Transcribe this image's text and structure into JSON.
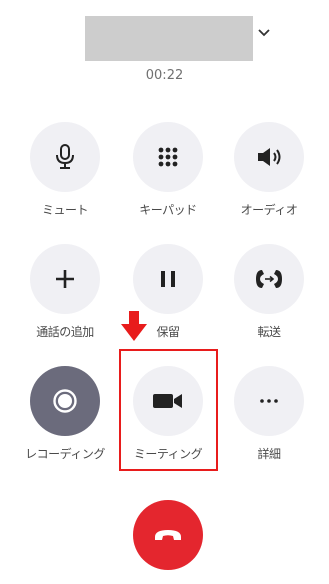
{
  "call": {
    "timer": "00:22"
  },
  "controls": [
    {
      "label": "ミュート",
      "icon": "microphone-icon"
    },
    {
      "label": "キーパッド",
      "icon": "keypad-icon"
    },
    {
      "label": "オーディオ",
      "icon": "speaker-icon"
    },
    {
      "label": "通話の追加",
      "icon": "plus-icon"
    },
    {
      "label": "保留",
      "icon": "pause-icon"
    },
    {
      "label": "転送",
      "icon": "transfer-icon"
    },
    {
      "label": "レコーディング",
      "icon": "record-icon"
    },
    {
      "label": "ミーティング",
      "icon": "video-camera-icon"
    },
    {
      "label": "詳細",
      "icon": "more-icon"
    }
  ],
  "colors": {
    "hangup": "#e4262e",
    "highlight": "#e81c1c",
    "button_bg": "#f0f0f4",
    "record_bg": "#6b6b7c"
  }
}
